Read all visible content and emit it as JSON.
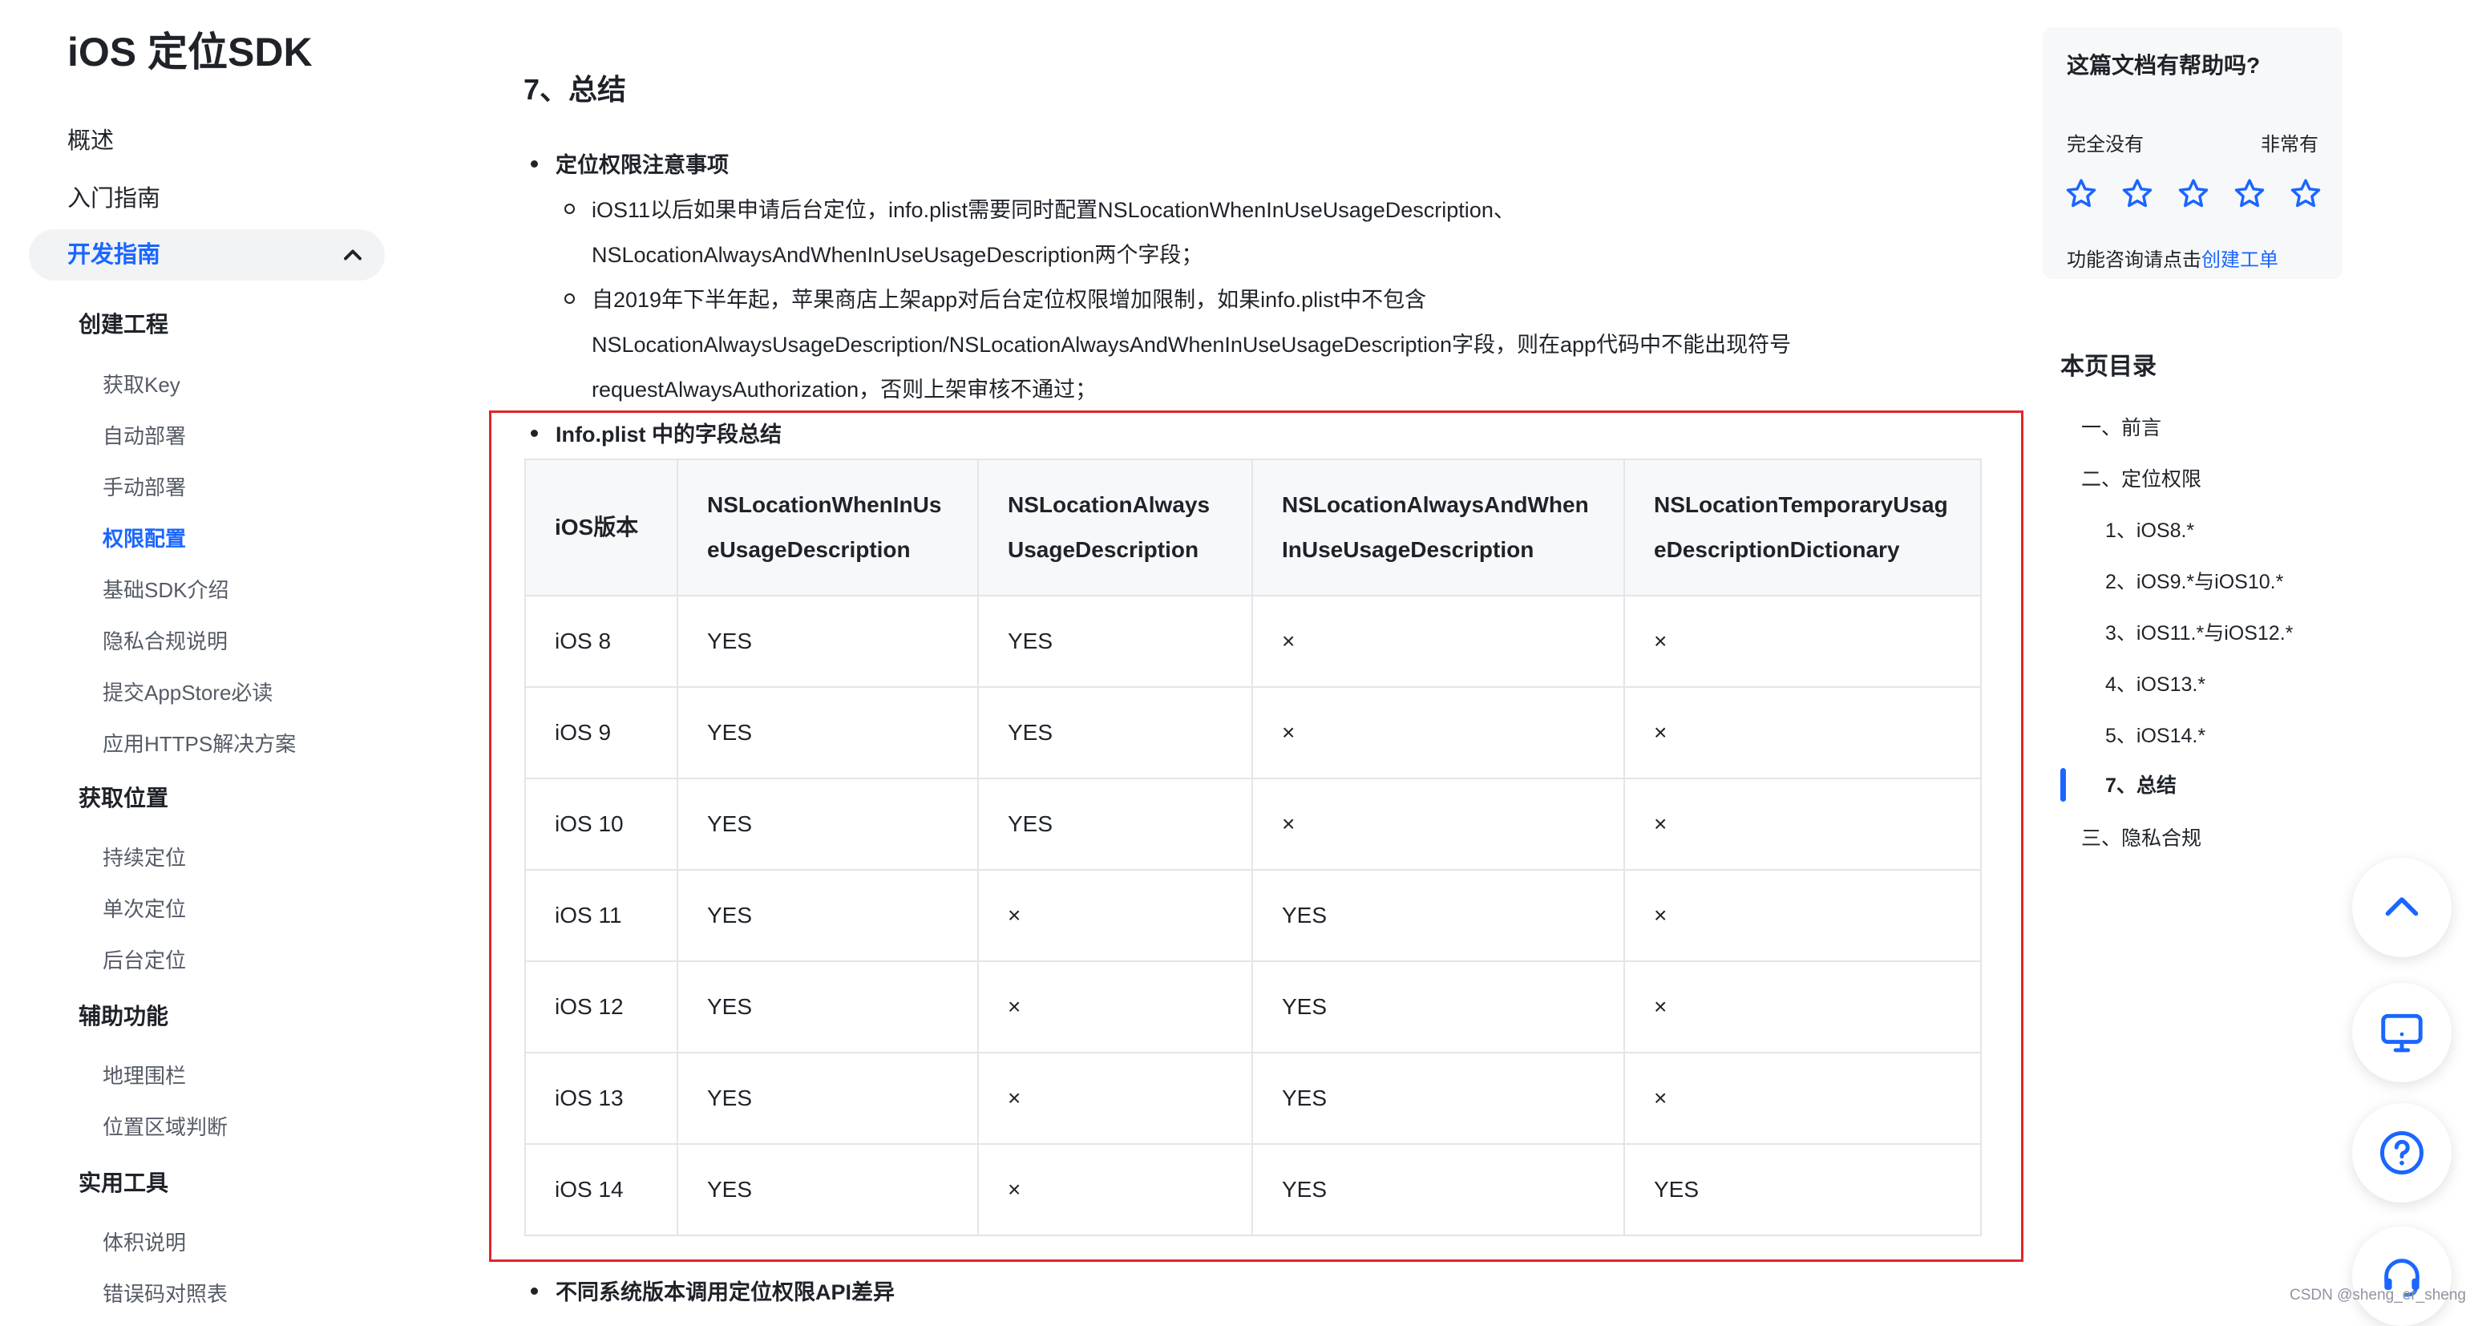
{
  "sidebar": {
    "title": "iOS 定位SDK",
    "top_items": [
      "概述",
      "入门指南"
    ],
    "active_section": "开发指南",
    "groups": [
      {
        "label": "创建工程",
        "items": [
          "获取Key",
          "自动部署",
          "手动部署",
          "权限配置",
          "基础SDK介绍",
          "隐私合规说明",
          "提交AppStore必读",
          "应用HTTPS解决方案"
        ]
      },
      {
        "label": "获取位置",
        "items": [
          "持续定位",
          "单次定位",
          "后台定位"
        ]
      },
      {
        "label": "辅助功能",
        "items": [
          "地理围栏",
          "位置区域判断"
        ]
      },
      {
        "label": "实用工具",
        "items": [
          "体积说明",
          "错误码对照表"
        ]
      }
    ],
    "current_item": "权限配置"
  },
  "content": {
    "heading": "7、总结",
    "bullet1": {
      "title": "定位权限注意事项",
      "point1": [
        "iOS11以后如果申请后台定位，info.plist需要同时配置NSLocationWhenInUseUsageDescription、",
        "NSLocationAlwaysAndWhenInUseUsageDescription两个字段；"
      ],
      "point2": [
        "自2019年下半年起，苹果商店上架app对后台定位权限增加限制，如果info.plist中不包含",
        "NSLocationAlwaysUsageDescription/NSLocationAlwaysAndWhenInUseUsageDescription字段，则在app代码中不能出现符号",
        "requestAlwaysAuthorization，否则上架审核不通过；"
      ]
    },
    "bullet2": {
      "title": "Info.plist 中的字段总结"
    },
    "table": {
      "headers": [
        "iOS版本",
        "NSLocationWhenInUseUsageDescription",
        "NSLocationAlwaysUsageDescription",
        "NSLocationAlwaysAndWhenInUseUsageDescription",
        "NSLocationTemporaryUsageDescriptionDictionary"
      ],
      "rows": [
        [
          "iOS 8",
          "YES",
          "YES",
          "×",
          "×"
        ],
        [
          "iOS 9",
          "YES",
          "YES",
          "×",
          "×"
        ],
        [
          "iOS 10",
          "YES",
          "YES",
          "×",
          "×"
        ],
        [
          "iOS 11",
          "YES",
          "×",
          "YES",
          "×"
        ],
        [
          "iOS 12",
          "YES",
          "×",
          "YES",
          "×"
        ],
        [
          "iOS 13",
          "YES",
          "×",
          "YES",
          "×"
        ],
        [
          "iOS 14",
          "YES",
          "×",
          "YES",
          "YES"
        ]
      ]
    },
    "bullet3": {
      "title": "不同系统版本调用定位权限API差异"
    }
  },
  "help": {
    "question": "这篇文档有帮助吗?",
    "low_label": "完全没有",
    "high_label": "非常有",
    "footer_prefix": "功能咨询请点击",
    "footer_link": "创建工单",
    "star_icon": "star-outline-icon"
  },
  "toc": {
    "title": "本页目录",
    "items": [
      "一、前言",
      "二、定位权限",
      "1、iOS8.*",
      "2、iOS9.*与iOS10.*",
      "3、iOS11.*与iOS12.*",
      "4、iOS13.*",
      "5、iOS14.*",
      "7、总结",
      "三、隐私合规"
    ],
    "current": "7、总结"
  },
  "floating_buttons": [
    "chevron-up-icon",
    "monitor-icon",
    "help-circle-icon",
    "headset-icon"
  ],
  "watermark": "CSDN @sheng_er_sheng",
  "colors": {
    "accent": "#1a66ff",
    "highlight_border": "#e0252b",
    "table_border": "#e3e5e8",
    "table_header_bg": "#f7f8fa"
  }
}
